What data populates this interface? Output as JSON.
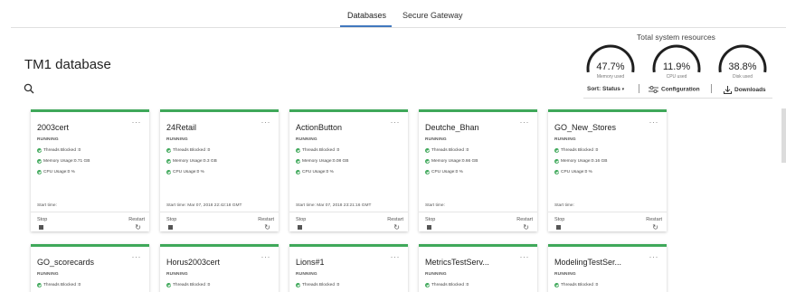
{
  "tabs": [
    {
      "label": "Databases",
      "active": true
    },
    {
      "label": "Secure Gateway",
      "active": false
    }
  ],
  "page_title": "TM1 database",
  "resources": {
    "title": "Total system resources",
    "gauges": [
      {
        "value": "47.7%",
        "label": "Memory used",
        "fraction": 0.477
      },
      {
        "value": "11.9%",
        "label": "CPU used",
        "fraction": 0.119
      },
      {
        "value": "38.8%",
        "label": "Disk used",
        "fraction": 0.388
      }
    ]
  },
  "toolbar": {
    "sort_label": "Sort:",
    "sort_value": "Status",
    "sort_caret": "▾",
    "configuration_label": "Configuration",
    "downloads_label": "Downloads"
  },
  "card_labels": {
    "status": "RUNNING",
    "threads_prefix": "Threads Blocked : ",
    "memory_prefix": "Memory Usage: ",
    "cpu_prefix": "CPU Usage: ",
    "start_prefix": "Start time:",
    "stop": "Stop",
    "restart": "Restart",
    "menu": "···"
  },
  "cards": [
    {
      "name": "2003cert",
      "threads": "0",
      "memory": "0.71 GB",
      "cpu": "0 %",
      "start": ""
    },
    {
      "name": "24Retail",
      "threads": "0",
      "memory": "0.3 GB",
      "cpu": "0 %",
      "start": "Mar 07, 2018 22:42:18 GMT"
    },
    {
      "name": "ActionButton",
      "threads": "0",
      "memory": "0.08 GB",
      "cpu": "0 %",
      "start": "Mar 07, 2018 23:21:16 GMT"
    },
    {
      "name": "Deutche_Bhan",
      "threads": "0",
      "memory": "0.66 GB",
      "cpu": "0 %",
      "start": ""
    },
    {
      "name": "GO_New_Stores",
      "threads": "0",
      "memory": "0.16 GB",
      "cpu": "0 %",
      "start": ""
    },
    {
      "name": "GO_scorecards",
      "threads": "0"
    },
    {
      "name": "Horus2003cert",
      "threads": "0"
    },
    {
      "name": "Lions#1",
      "threads": "0"
    },
    {
      "name": "MetricsTestServ...",
      "threads": "0"
    },
    {
      "name": "ModelingTestSer...",
      "threads": "0"
    }
  ],
  "colors": {
    "accent": "#4178be",
    "running": "#3fa85a",
    "gauge": "#1f1f1f"
  }
}
